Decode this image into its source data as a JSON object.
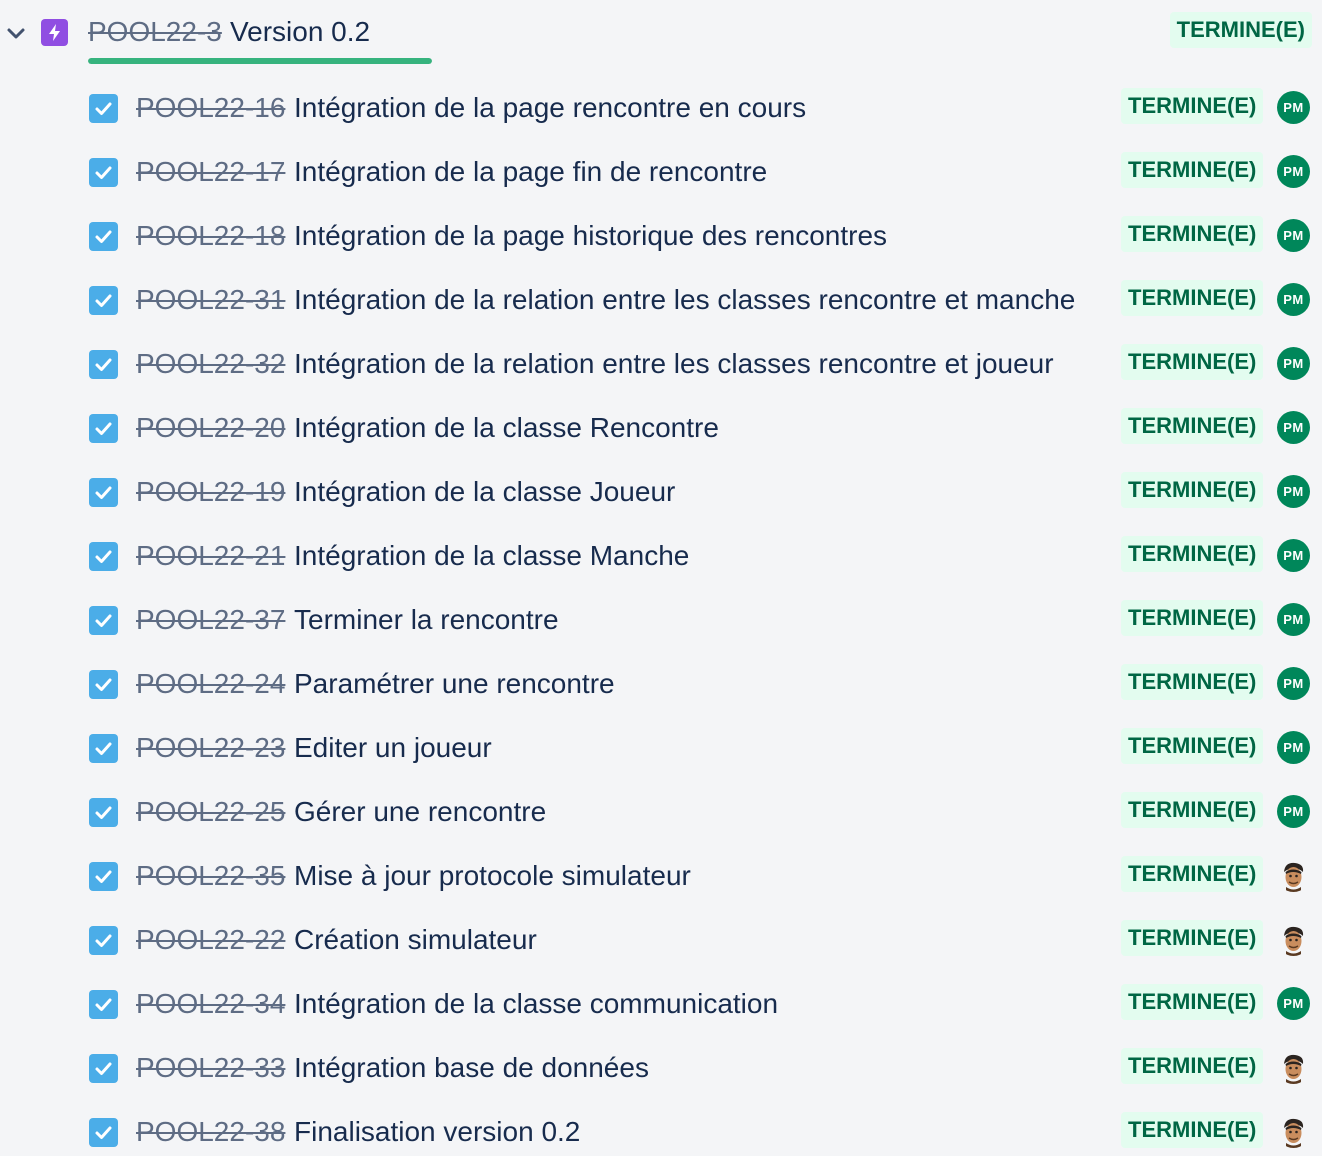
{
  "epic": {
    "key": "POOL22-3",
    "title": "Version 0.2",
    "status": "TERMINE(E)",
    "progress": 1.0,
    "icon": "lightning-icon",
    "expand_icon": "chevron-down-icon"
  },
  "issues": [
    {
      "key": "POOL22-16",
      "summary": "Intégration de la page rencontre en cours",
      "status": "TERMINE(E)",
      "assignee": {
        "type": "initials",
        "initials": "PM"
      }
    },
    {
      "key": "POOL22-17",
      "summary": "Intégration de la page fin de rencontre",
      "status": "TERMINE(E)",
      "assignee": {
        "type": "initials",
        "initials": "PM"
      }
    },
    {
      "key": "POOL22-18",
      "summary": "Intégration de la page historique des rencontres",
      "status": "TERMINE(E)",
      "assignee": {
        "type": "initials",
        "initials": "PM"
      }
    },
    {
      "key": "POOL22-31",
      "summary": "Intégration de la relation entre les classes rencontre et manche",
      "status": "TERMINE(E)",
      "assignee": {
        "type": "initials",
        "initials": "PM"
      }
    },
    {
      "key": "POOL22-32",
      "summary": "Intégration de la relation entre les classes rencontre et joueur",
      "status": "TERMINE(E)",
      "assignee": {
        "type": "initials",
        "initials": "PM"
      }
    },
    {
      "key": "POOL22-20",
      "summary": "Intégration de la classe Rencontre",
      "status": "TERMINE(E)",
      "assignee": {
        "type": "initials",
        "initials": "PM"
      }
    },
    {
      "key": "POOL22-19",
      "summary": "Intégration de la classe Joueur",
      "status": "TERMINE(E)",
      "assignee": {
        "type": "initials",
        "initials": "PM"
      }
    },
    {
      "key": "POOL22-21",
      "summary": "Intégration de la classe Manche",
      "status": "TERMINE(E)",
      "assignee": {
        "type": "initials",
        "initials": "PM"
      }
    },
    {
      "key": "POOL22-37",
      "summary": "Terminer la rencontre",
      "status": "TERMINE(E)",
      "assignee": {
        "type": "initials",
        "initials": "PM"
      }
    },
    {
      "key": "POOL22-24",
      "summary": "Paramétrer une rencontre",
      "status": "TERMINE(E)",
      "assignee": {
        "type": "initials",
        "initials": "PM"
      }
    },
    {
      "key": "POOL22-23",
      "summary": "Editer un joueur",
      "status": "TERMINE(E)",
      "assignee": {
        "type": "initials",
        "initials": "PM"
      }
    },
    {
      "key": "POOL22-25",
      "summary": "Gérer une rencontre",
      "status": "TERMINE(E)",
      "assignee": {
        "type": "initials",
        "initials": "PM"
      }
    },
    {
      "key": "POOL22-35",
      "summary": "Mise à jour protocole simulateur",
      "status": "TERMINE(E)",
      "assignee": {
        "type": "photo"
      }
    },
    {
      "key": "POOL22-22",
      "summary": "Création simulateur",
      "status": "TERMINE(E)",
      "assignee": {
        "type": "photo"
      }
    },
    {
      "key": "POOL22-34",
      "summary": "Intégration de la classe communication",
      "status": "TERMINE(E)",
      "assignee": {
        "type": "initials",
        "initials": "PM"
      }
    },
    {
      "key": "POOL22-33",
      "summary": "Intégration base de données",
      "status": "TERMINE(E)",
      "assignee": {
        "type": "photo"
      }
    },
    {
      "key": "POOL22-38",
      "summary": "Finalisation version 0.2",
      "status": "TERMINE(E)",
      "assignee": {
        "type": "photo"
      }
    }
  ],
  "colors": {
    "background": "#f4f5f7",
    "epic_icon": "#904ee2",
    "task_icon": "#4bade8",
    "status_bg": "#e3fcef",
    "status_text": "#006644",
    "progress": "#36b37e",
    "avatar_bg": "#00875a",
    "key_text": "#5e6c84",
    "summary_text": "#172b4d"
  }
}
